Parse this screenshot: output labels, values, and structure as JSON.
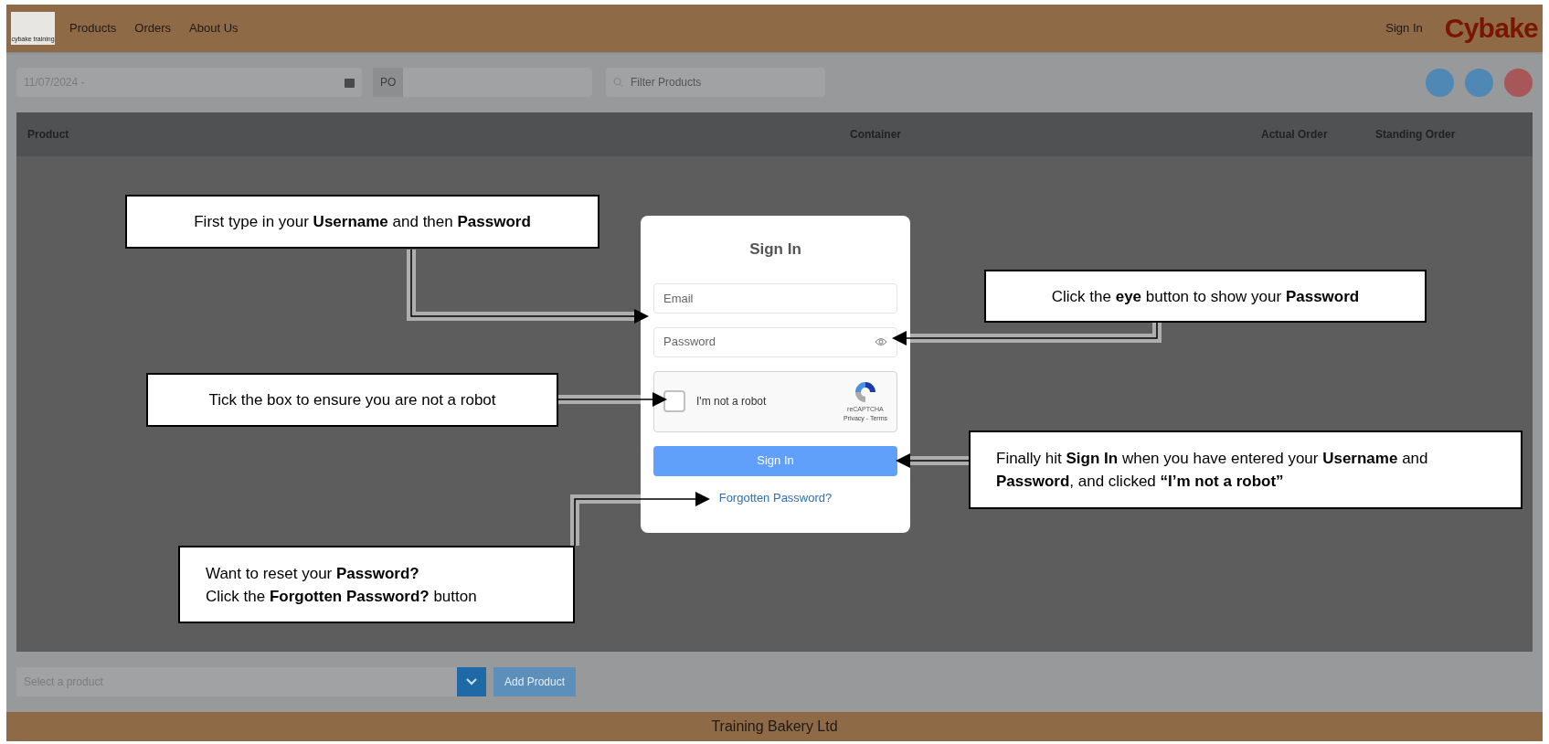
{
  "header": {
    "logo_caption": "cybake training",
    "nav": [
      "Products",
      "Orders",
      "About Us"
    ],
    "sign_in": "Sign In",
    "brand": "Cybake"
  },
  "toolbar": {
    "date": "11/07/2024 -",
    "po": "PO",
    "filter": {
      "placeholder": "Filter Products"
    }
  },
  "table": {
    "columns": [
      "Product",
      "Container",
      "Actual Order",
      "Standing Order"
    ]
  },
  "bottom": {
    "select": {
      "placeholder": "Select a product"
    },
    "add_button": "Add Product"
  },
  "footer": "Training Bakery Ltd",
  "dialog": {
    "title": "Sign In",
    "email": {
      "placeholder": "Email"
    },
    "password": {
      "placeholder": "Password"
    },
    "captcha": {
      "checked": false,
      "label": "I'm not a robot",
      "brand": "reCAPTCHA",
      "links": "Privacy - Terms"
    },
    "submit": "Sign In",
    "forgot": "Forgotten Password?"
  },
  "callouts": [
    {
      "lines": [
        "First type in your **Username** and then **Password**"
      ]
    },
    {
      "lines": [
        "Click the **eye** button to show your **Password**"
      ]
    },
    {
      "lines": [
        "Tick the box to ensure you are not a robot"
      ]
    },
    {
      "lines": [
        "Finally hit **Sign In** when you have entered your **Username** and **Password**, and clicked **“I’m not a robot”**"
      ]
    },
    {
      "lines": [
        "Want to reset your **Password?**",
        "Click the **Forgotten Password?** button"
      ]
    }
  ]
}
